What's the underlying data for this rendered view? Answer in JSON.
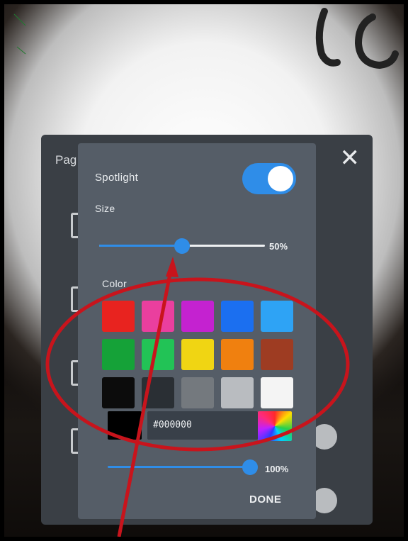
{
  "background_panel": {
    "title_fragment": "Pag",
    "close_glyph": "✕"
  },
  "spotlight": {
    "title": "Spotlight",
    "enabled": true,
    "size_label": "Size",
    "size_percent": 50,
    "size_value_text": "50%",
    "color_label": "Color",
    "swatches": [
      [
        "#e8231f",
        "#ea3f9e",
        "#c422d0",
        "#1b6ff0",
        "#2ea3f5"
      ],
      [
        "#15a238",
        "#22c356",
        "#f0d513",
        "#f0800f",
        "#9e3c22"
      ],
      [
        "#0c0c0c",
        "#2a2f34",
        "#74797e",
        "#b9bcc0",
        "#f4f4f4"
      ]
    ],
    "hex_value": "#000000",
    "opacity_percent": 100,
    "opacity_value_text": "100%",
    "done_label": "DONE"
  },
  "colors": {
    "accent": "#2f8de8",
    "annotation_red": "#c8141c"
  }
}
